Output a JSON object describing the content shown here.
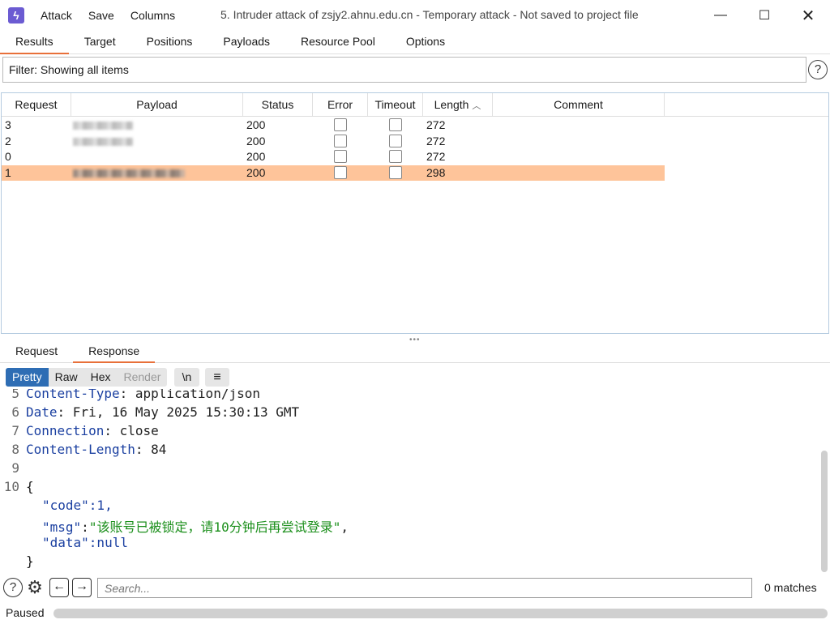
{
  "window": {
    "title": "5. Intruder attack of zsjy2.ahnu.edu.cn - Temporary attack - Not saved to project file",
    "menu": [
      "Attack",
      "Save",
      "Columns"
    ],
    "app_icon": "bolt-icon"
  },
  "tabs": [
    "Results",
    "Target",
    "Positions",
    "Payloads",
    "Resource Pool",
    "Options"
  ],
  "filter": {
    "text": "Filter: Showing all items"
  },
  "table": {
    "columns": [
      "Request",
      "Payload",
      "Status",
      "Error",
      "Timeout",
      "Length",
      "Comment"
    ],
    "sort_indicator": "^",
    "rows": [
      {
        "request": "3",
        "status": "200",
        "length": "272",
        "selected": false
      },
      {
        "request": "2",
        "status": "200",
        "length": "272",
        "selected": false
      },
      {
        "request": "0",
        "status": "200",
        "length": "272",
        "selected": false
      },
      {
        "request": "1",
        "status": "200",
        "length": "298",
        "selected": true
      }
    ],
    "selected_color": "#fec49a"
  },
  "subtabs": [
    "Request",
    "Response"
  ],
  "format_buttons": [
    "Pretty",
    "Raw",
    "Hex",
    "Render"
  ],
  "newline_button": "\\n",
  "menu_button_icon": "hamburger-icon",
  "code_lines": {
    "l5": {
      "num": "5",
      "key": "Content-Type",
      "sep": ": ",
      "val": "application/json"
    },
    "l6": {
      "num": "6",
      "key": "Date",
      "sep": ": ",
      "val": "Fri, 16 May 2025 15:30:13 GMT"
    },
    "l7": {
      "num": "7",
      "key": "Connection",
      "sep": ": ",
      "val": "close"
    },
    "l8": {
      "num": "8",
      "key": "Content-Length",
      "sep": ": ",
      "val": "84"
    },
    "l9": {
      "num": "9"
    },
    "l10": {
      "num": "10",
      "text": "{"
    },
    "code_key": "\"code\"",
    "code_val": ":1,",
    "msg_key": "\"msg\"",
    "msg_colon": ":",
    "msg_val": "\"该账号已被锁定，请10分钟后再尝试登录\"",
    "msg_comma": ",",
    "data_key": "\"data\"",
    "data_val": ":null",
    "close": "}"
  },
  "search": {
    "placeholder": "Search...",
    "matches": "0 matches"
  },
  "status": {
    "text": "Paused"
  },
  "colors": {
    "accent": "#e8703a",
    "active_format": "#2e6db4",
    "header_key": "#1a3fa0",
    "json_string": "#1b8f1b"
  }
}
